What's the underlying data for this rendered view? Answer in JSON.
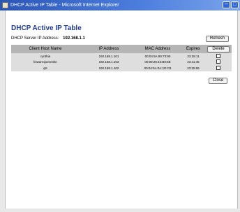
{
  "window": {
    "title": "DHCP Active IP Table - Microsoft Internet Explorer"
  },
  "page": {
    "heading": "DHCP Active IP Table",
    "server_label": "DHCP Server IP Address:",
    "server_ip": "192.168.1.1",
    "refresh_label": "Refresh",
    "delete_label": "Delete",
    "close_label": "Close"
  },
  "table": {
    "headers": [
      "Client Host Name",
      "IP Address",
      "MAC Address",
      "Expires"
    ],
    "rows": [
      {
        "host": "cynthia",
        "ip": "192.168.1.101",
        "mac": "00:04:5A:90:73:90",
        "expires": "23:25:11"
      },
      {
        "host": "linwarrojoeventin",
        "ip": "192.168.1.103",
        "mac": "00:09:25:42:B0:8E",
        "expires": "23:11:45"
      },
      {
        "host": "qtc",
        "ip": "192.168.1.102",
        "mac": "00:04:5A:0A:1D:C8",
        "expires": "23:25:06"
      }
    ]
  }
}
